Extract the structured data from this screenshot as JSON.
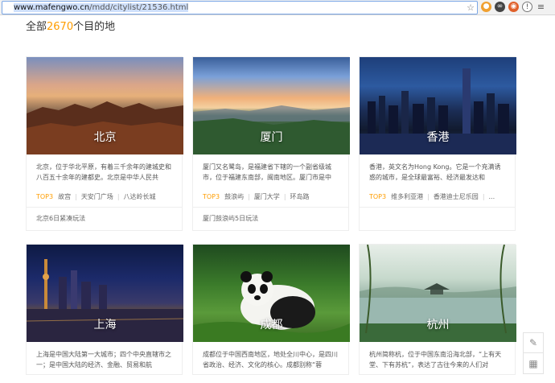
{
  "browser": {
    "url_host": "www.mafengwo.cn",
    "url_path": "/mdd/citylist/21536.html",
    "star_icon": "star-icon",
    "extension_icons": [
      "ext-icon-1",
      "ext-icon-2",
      "ext-icon-3",
      "ext-icon-4",
      "menu-icon"
    ]
  },
  "heading": {
    "prefix": "全部",
    "count": "2670",
    "suffix": "个目的地",
    "count_color": "#ff9d00"
  },
  "cities": [
    {
      "name": "北京",
      "desc": "北京，位于华北平原，有着三千余年的建城史和八百五十余年的建都史。北京是中华人民共",
      "top3_label": "TOP3",
      "top3": [
        "故宫",
        "天安门广场",
        "八达岭长城"
      ],
      "guide": "北京6日紧凑玩法"
    },
    {
      "name": "厦门",
      "desc": "厦门又名鹭岛，是福建省下辖的一个副省级城市，位于福建东南部，闽南地区。厦门市是中",
      "top3_label": "TOP3",
      "top3": [
        "鼓浪屿",
        "厦门大学",
        "环岛路"
      ],
      "guide": "厦门鼓浪屿5日玩法"
    },
    {
      "name": "香港",
      "desc": "香港，英文名为Hong Kong。它是一个充满诱惑的城市，是全球最富裕、经济最发达和",
      "top3_label": "TOP3",
      "top3": [
        "维多利亚港",
        "香港迪士尼乐园",
        "..."
      ],
      "guide": ""
    },
    {
      "name": "上海",
      "desc": "上海是中国大陆第一大城市；四个中央直辖市之一；是中国大陆的经济、金融、贸易和航"
    },
    {
      "name": "成都",
      "desc": "成都位于中国西南地区，地处全川中心，是四川省政治、经济、文化的核心。成都别称“蓉"
    },
    {
      "name": "杭州",
      "desc": "杭州简称杭，位于中国东南沿海北部，“上有天堂、下有苏杭”，表达了古往今来的人们对"
    }
  ],
  "side_tools": [
    "edit-icon",
    "qrcode-icon"
  ]
}
